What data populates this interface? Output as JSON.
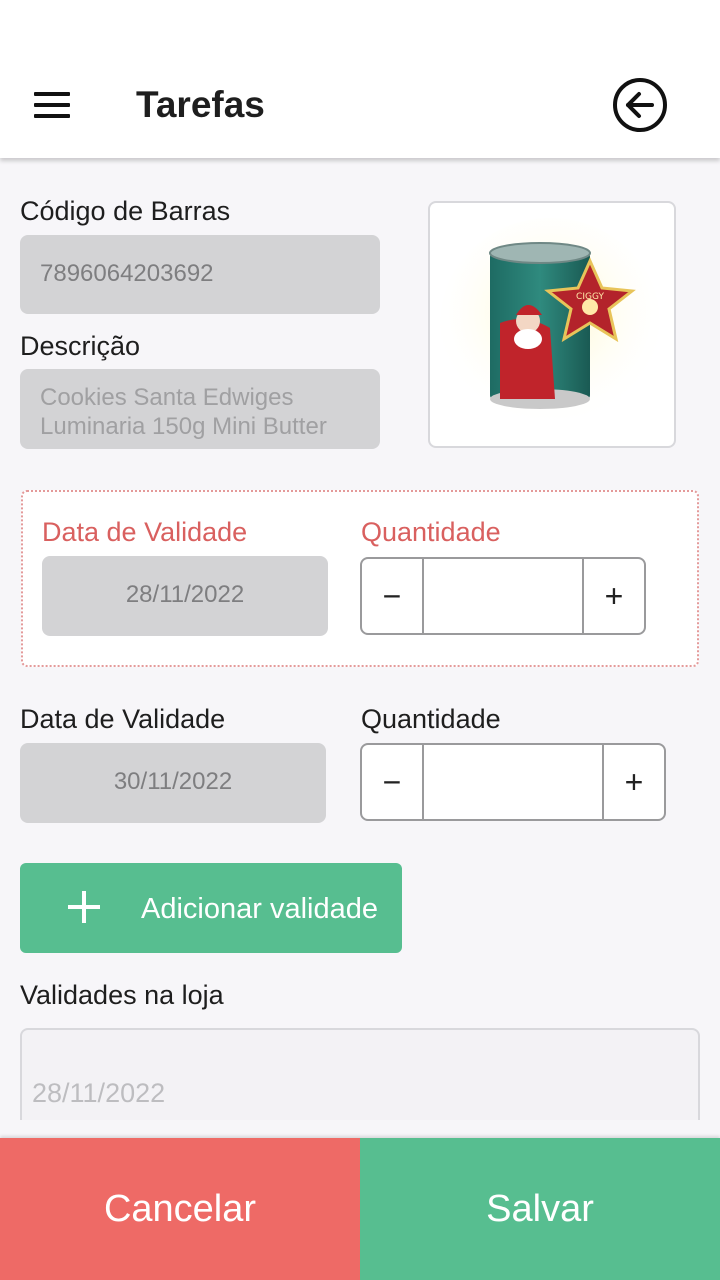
{
  "header": {
    "title": "Tarefas"
  },
  "icons": {
    "menu": "menu-icon",
    "back": "arrow-left-circle-icon",
    "plus": "plus-icon",
    "product": "product-image"
  },
  "barcode": {
    "label": "Código de Barras",
    "value": "7896064203692"
  },
  "description": {
    "label": "Descrição",
    "value": "Cookies Santa Edwiges Luminaria 150g Mini Butter"
  },
  "entries": [
    {
      "date_label": "Data de Validade",
      "date_value": "28/11/2022",
      "qty_label": "Quantidade",
      "qty_value": "",
      "minus": "−",
      "plus": "+"
    },
    {
      "date_label": "Data de Validade",
      "date_value": "30/11/2022",
      "qty_label": "Quantidade",
      "qty_value": "",
      "minus": "−",
      "plus": "+"
    }
  ],
  "add_button": {
    "label": "Adicionar validade"
  },
  "store": {
    "label": "Validades na loja",
    "dates": [
      "28/11/2022"
    ]
  },
  "footer": {
    "cancel": "Cancelar",
    "save": "Salvar"
  },
  "colors": {
    "accent_green": "#57be90",
    "cancel_red": "#ee6a66",
    "error_red": "#d9605f",
    "field_gray": "#d3d3d5"
  }
}
